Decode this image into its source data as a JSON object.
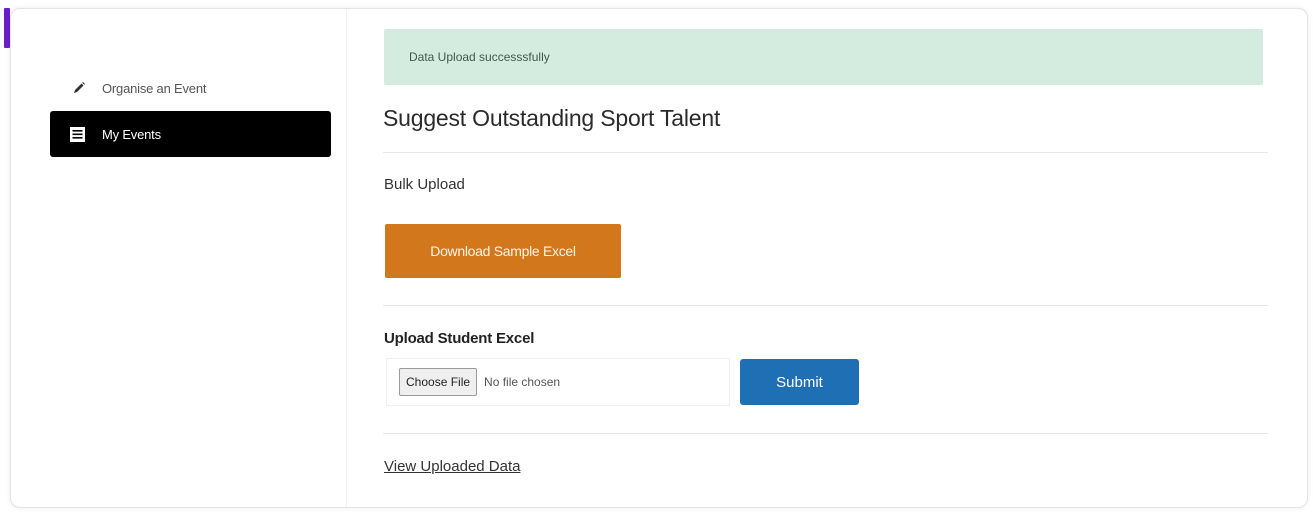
{
  "sidebar": {
    "items": [
      {
        "label": "Organise an Event",
        "icon": "pencil-icon"
      },
      {
        "label": "My Events",
        "icon": "list-icon",
        "active": true
      }
    ]
  },
  "alert": {
    "message": "Data Upload successsfully"
  },
  "page": {
    "title": "Suggest Outstanding Sport Talent",
    "bulk_upload_label": "Bulk Upload",
    "download_button": "Download Sample Excel",
    "upload_label": "Upload Student Excel",
    "choose_file_button": "Choose File",
    "no_file_text": "No file chosen",
    "submit_button": "Submit",
    "view_link": "View Uploaded Data"
  },
  "colors": {
    "accent": "#6a1fc9",
    "alert_bg": "#d4ecdf",
    "download_button": "#d2771c",
    "submit_button": "#1f6fb5",
    "active_nav": "#000000"
  }
}
